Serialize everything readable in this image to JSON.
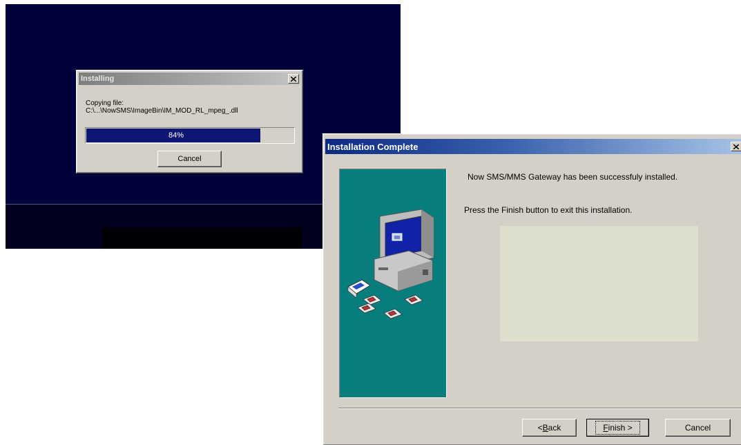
{
  "installing_dialog": {
    "title": "Installing",
    "copying_label": "Copying file:",
    "file_path": "C:\\...\\NowSMS\\ImageBin\\IM_MOD_RL_mpeg_.dll",
    "progress_percent": 84,
    "progress_label": "84%",
    "cancel_label": "Cancel"
  },
  "complete_dialog": {
    "title": "Installation Complete",
    "installed_message": "Now SMS/MMS Gateway has been successfuly installed.",
    "finish_instruction": "Press the Finish button to exit this installation.",
    "back_button": {
      "mnemonic": "B",
      "rest": "ack",
      "prefix": "< "
    },
    "finish_button": {
      "mnemonic": "F",
      "rest": "inish",
      "suffix": " >"
    },
    "cancel_label": "Cancel"
  },
  "colors": {
    "setup_background": "#02003a",
    "progress_fill": "#0e1573",
    "side_panel": "#087d7d",
    "titlebar_active": "#0b2a83"
  }
}
